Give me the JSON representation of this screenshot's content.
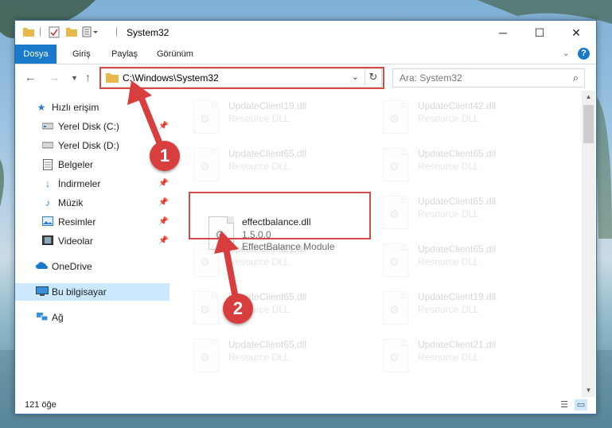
{
  "window": {
    "title": "System32",
    "controls": {
      "minimize": "─",
      "maximize": "☐",
      "close": "✕"
    }
  },
  "ribbon": {
    "tabs": [
      "Dosya",
      "Giriş",
      "Paylaş",
      "Görünüm"
    ]
  },
  "address": {
    "path": "C:\\Windows\\System32",
    "search_placeholder": "Ara: System32"
  },
  "nav": {
    "items": [
      {
        "label": "Hızlı erişim",
        "icon": "star-icon"
      },
      {
        "label": "Yerel Disk (C:)",
        "icon": "drive-icon"
      },
      {
        "label": "Yerel Disk (D:)",
        "icon": "drive-icon"
      },
      {
        "label": "Belgeler",
        "icon": "documents-icon"
      },
      {
        "label": "İndirmeler",
        "icon": "downloads-icon"
      },
      {
        "label": "Müzik",
        "icon": "music-icon"
      },
      {
        "label": "Resimler",
        "icon": "pictures-icon"
      },
      {
        "label": "Videolar",
        "icon": "videos-icon"
      },
      {
        "label": "OneDrive",
        "icon": "cloud-icon"
      },
      {
        "label": "Bu bilgisayar",
        "icon": "computer-icon"
      },
      {
        "label": "Ağ",
        "icon": "network-icon"
      }
    ]
  },
  "files": {
    "highlighted": {
      "name": "effectbalance.dll",
      "version": "1.5.0.0",
      "description": "EffectBalance Module"
    },
    "faded": [
      {
        "name": "UpdateClient19.dll",
        "type": "Resource DLL"
      },
      {
        "name": "UpdateClient42.dll",
        "type": "Resource DLL"
      },
      {
        "name": "UpdateClient65.dll",
        "type": "Resource DLL"
      },
      {
        "name": "UpdateClient65.dll",
        "type": "Resource DLL"
      },
      {
        "name": "UpdateClient65.dll",
        "type": "Resource DLL"
      },
      {
        "name": "UpdateClient21.dll",
        "type": "Resource DLL"
      },
      {
        "name": "UpdateClient65.dll",
        "type": "Resource DLL"
      },
      {
        "name": "UpdateClient65.dll",
        "type": "Resource DLL"
      },
      {
        "name": "UpdateClient19.dll",
        "type": "Resource DLL"
      },
      {
        "name": "UpdateClient65.dll",
        "type": "Resource DLL"
      },
      {
        "name": "UpdateClient21.dll",
        "type": "Resource DLL"
      }
    ]
  },
  "status": {
    "count_text": "121 öğe"
  },
  "callouts": {
    "one": "1",
    "two": "2"
  },
  "colors": {
    "accent": "#1979ca",
    "highlight": "#d84a4a",
    "selected": "#cce8ff"
  }
}
